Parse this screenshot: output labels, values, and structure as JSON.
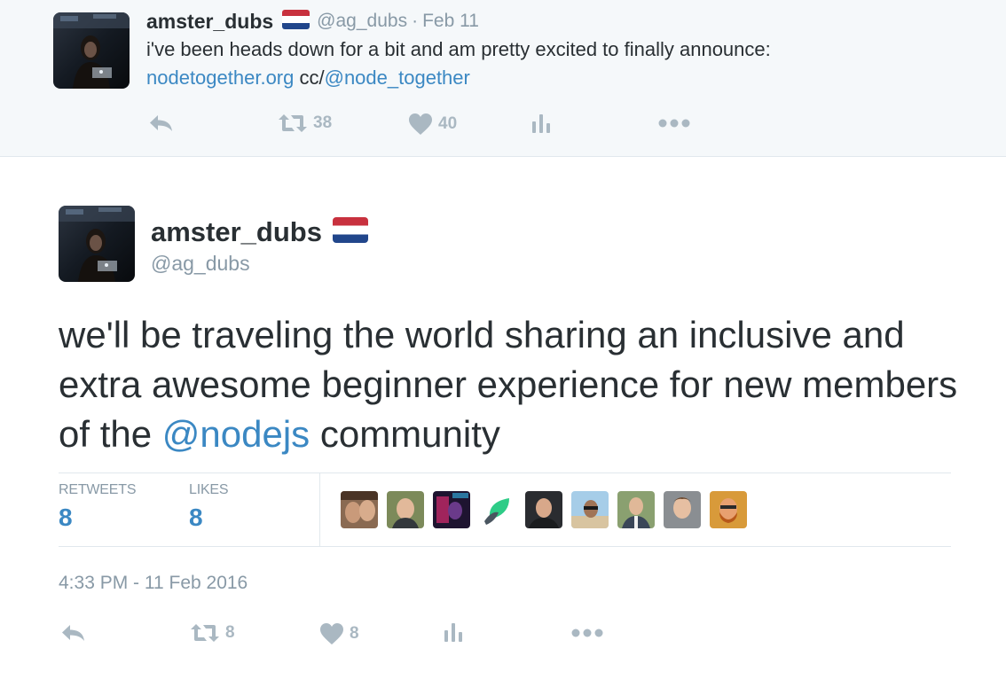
{
  "parent_tweet": {
    "name": "amster_dubs",
    "handle": "@ag_dubs",
    "separator": "·",
    "date": "Feb 11",
    "text_line1": "i've been heads down for a bit and am pretty excited to finally announce:",
    "link_url_text": "nodetogether.org",
    "cc_text": " cc/",
    "mention": "@node_together",
    "retweet_count": "38",
    "like_count": "40",
    "icons": [
      "reply-icon",
      "retweet-icon",
      "heart-icon",
      "analytics-icon",
      "more-icon"
    ]
  },
  "main_tweet": {
    "name": "amster_dubs",
    "handle": "@ag_dubs",
    "text_before_mention": "we'll be traveling the world sharing an inclusive and extra awesome beginner experience for new members of the ",
    "mention": "@nodejs",
    "text_after_mention": " community",
    "stats": {
      "retweets_label": "RETWEETS",
      "retweets_value": "8",
      "likes_label": "LIKES",
      "likes_value": "8"
    },
    "liker_avatars": 9,
    "timestamp": "4:33 PM - 11 Feb 2016",
    "retweet_count": "8",
    "like_count": "8"
  },
  "colors": {
    "link": "#3b88c3",
    "muted": "#8899a6",
    "icon": "#aab8c2",
    "parent_bg": "#f5f8fa",
    "border": "#e1e8ed",
    "flag_red": "#c8313e",
    "flag_blue": "#21468b"
  }
}
